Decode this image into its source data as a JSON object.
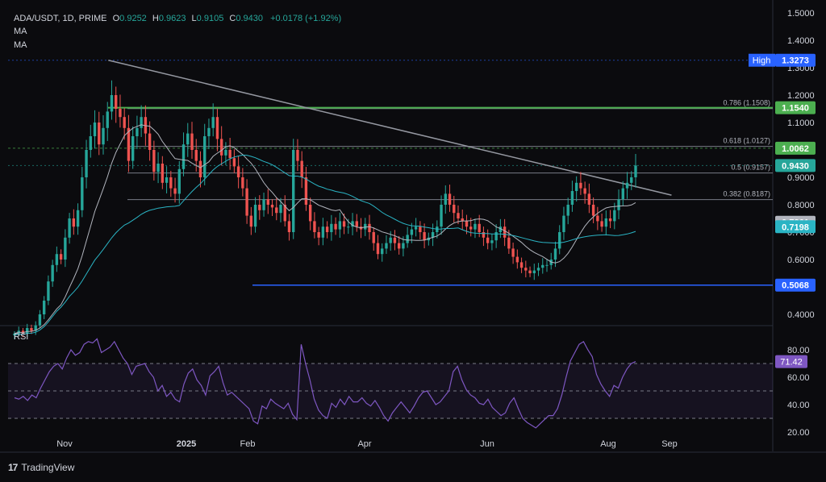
{
  "header": {
    "symbol": "ADA/USDT, 1D, PRIME",
    "open_key": "O",
    "open": "0.9252",
    "high_key": "H",
    "high": "0.9623",
    "low_key": "L",
    "low": "0.9105",
    "close_key": "C",
    "close": "0.9430",
    "change": "+0.0178 (+1.92%)"
  },
  "indicators": {
    "ma1": "MA",
    "ma2": "MA",
    "rsi": "RSI"
  },
  "footer": {
    "brand": "TradingView",
    "logo": "17"
  },
  "colors": {
    "background": "#0b0b0e",
    "up": "#26a69a",
    "down": "#ef5350",
    "ma_fast": "#b2b5be",
    "ma_slow": "#2ab4c4",
    "rsi": "#7e57c2",
    "green_line": "#4caf50",
    "blue_line": "#2962ff",
    "fib": "#787b86"
  },
  "chart_data": [
    {
      "type": "candlestick",
      "pair": "ADA/USDT",
      "timeframe": "1D",
      "y_ticks": [
        "1.5000",
        "1.4000",
        "1.3000",
        "1.2000",
        "1.1000",
        "1.0000",
        "0.9000",
        "0.8000",
        "0.7000",
        "0.6000",
        "0.5000",
        "0.4000"
      ],
      "ylim": [
        0.36,
        1.5
      ],
      "x_ticks": [
        "Nov",
        "2025",
        "Feb",
        "Apr",
        "Jun",
        "Aug",
        "Sep"
      ],
      "price_labels": [
        {
          "name": "High",
          "text": "1.3273",
          "value": 1.3273,
          "color": "#2962ff"
        },
        {
          "text": "1.1540",
          "value": 1.154,
          "color": "#4caf50"
        },
        {
          "text": "1.0062",
          "value": 1.0062,
          "color": "#4caf50"
        },
        {
          "text": "0.9430",
          "value": 0.943,
          "color": "#26a69a"
        },
        {
          "text": "0.7361",
          "value": 0.7361,
          "color": "#b2b5be"
        },
        {
          "text": "0.7198",
          "value": 0.7198,
          "color": "#2ab4c4"
        },
        {
          "text": "0.5068",
          "value": 0.5068,
          "color": "#2962ff"
        }
      ],
      "fib_levels": [
        {
          "label": "0.786 (1.1508)",
          "value": 1.1508
        },
        {
          "label": "0.618 (1.0127)",
          "value": 1.0127
        },
        {
          "label": "0.5 (0.9157)",
          "value": 0.9157
        },
        {
          "label": "0.382 (0.8187)",
          "value": 0.8187
        }
      ],
      "horizontal_lines": [
        {
          "value": 1.154,
          "color": "#4caf50"
        },
        {
          "value": 0.5068,
          "color": "#2962ff"
        }
      ],
      "trendline": {
        "from": {
          "date": "2024-11-23",
          "price": 1.3273
        },
        "to": {
          "date": "2025-09-02",
          "price": 0.835
        }
      },
      "closes": [
        0.33,
        0.34,
        0.33,
        0.35,
        0.34,
        0.36,
        0.4,
        0.45,
        0.52,
        0.58,
        0.62,
        0.6,
        0.68,
        0.75,
        0.72,
        0.78,
        0.9,
        1.0,
        1.05,
        1.1,
        1.02,
        1.08,
        1.14,
        1.2,
        1.15,
        1.12,
        1.08,
        0.96,
        1.05,
        1.08,
        1.12,
        1.06,
        1.0,
        0.92,
        0.95,
        0.88,
        0.9,
        0.86,
        0.84,
        0.93,
        1.02,
        1.06,
        1.0,
        0.96,
        0.9,
        1.05,
        1.08,
        1.12,
        1.04,
        0.98,
        1.0,
        0.97,
        0.94,
        0.9,
        0.86,
        0.76,
        0.72,
        0.8,
        0.78,
        0.82,
        0.8,
        0.79,
        0.77,
        0.8,
        0.74,
        0.7,
        1.0,
        0.96,
        0.9,
        0.8,
        0.74,
        0.7,
        0.68,
        0.72,
        0.7,
        0.73,
        0.71,
        0.74,
        0.72,
        0.72,
        0.74,
        0.72,
        0.71,
        0.73,
        0.7,
        0.66,
        0.62,
        0.64,
        0.66,
        0.68,
        0.66,
        0.64,
        0.66,
        0.69,
        0.71,
        0.72,
        0.7,
        0.67,
        0.68,
        0.7,
        0.72,
        0.8,
        0.84,
        0.8,
        0.77,
        0.75,
        0.74,
        0.72,
        0.71,
        0.73,
        0.7,
        0.68,
        0.66,
        0.67,
        0.7,
        0.72,
        0.68,
        0.64,
        0.61,
        0.59,
        0.57,
        0.56,
        0.55,
        0.56,
        0.57,
        0.58,
        0.58,
        0.6,
        0.64,
        0.7,
        0.76,
        0.8,
        0.85,
        0.88,
        0.86,
        0.84,
        0.8,
        0.76,
        0.74,
        0.72,
        0.75,
        0.74,
        0.78,
        0.82,
        0.86,
        0.88,
        0.9,
        0.943
      ]
    },
    {
      "type": "line",
      "name": "RSI",
      "y_ticks": [
        "80.00",
        "60.00",
        "40.00",
        "20.00"
      ],
      "ylim": [
        17,
        90
      ],
      "bands": [
        70,
        50,
        30
      ],
      "last_value": "71.42",
      "values": [
        45,
        44,
        46,
        43,
        47,
        45,
        52,
        58,
        64,
        68,
        70,
        66,
        74,
        80,
        76,
        78,
        84,
        86,
        85,
        88,
        78,
        80,
        82,
        86,
        80,
        74,
        70,
        62,
        68,
        69,
        70,
        64,
        60,
        50,
        54,
        46,
        49,
        44,
        42,
        55,
        63,
        66,
        58,
        54,
        47,
        61,
        64,
        68,
        56,
        47,
        49,
        46,
        43,
        40,
        37,
        28,
        26,
        39,
        37,
        44,
        41,
        39,
        37,
        41,
        33,
        29,
        84,
        70,
        58,
        44,
        36,
        32,
        30,
        41,
        38,
        44,
        40,
        46,
        42,
        42,
        45,
        41,
        39,
        43,
        38,
        32,
        28,
        34,
        38,
        42,
        38,
        34,
        39,
        45,
        49,
        50,
        45,
        40,
        42,
        46,
        50,
        64,
        68,
        58,
        51,
        47,
        45,
        41,
        40,
        44,
        38,
        35,
        32,
        34,
        41,
        45,
        37,
        30,
        27,
        25,
        23,
        26,
        29,
        32,
        32,
        37,
        47,
        60,
        72,
        78,
        84,
        86,
        80,
        75,
        62,
        55,
        50,
        46,
        54,
        52,
        60,
        66,
        70,
        71.42
      ]
    }
  ]
}
